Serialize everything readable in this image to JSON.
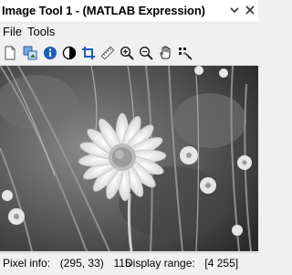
{
  "window": {
    "title": "Image Tool 1 - (MATLAB Expression)",
    "collapse_icon": "chevron-down-icon",
    "close_icon": "close-icon"
  },
  "menu": {
    "items": [
      {
        "label": "File"
      },
      {
        "label": "Tools"
      }
    ]
  },
  "toolbar": {
    "tools": [
      {
        "icon": "new-figure-icon"
      },
      {
        "icon": "export-icon"
      },
      {
        "icon": "image-info-icon"
      },
      {
        "icon": "contrast-icon"
      },
      {
        "icon": "crop-icon"
      },
      {
        "icon": "measure-distance-icon"
      },
      {
        "icon": "zoom-in-icon"
      },
      {
        "icon": "zoom-out-icon"
      },
      {
        "icon": "pan-hand-icon"
      },
      {
        "icon": "pixel-region-icon"
      }
    ]
  },
  "image": {
    "description_icon": "grayscale-flower-image"
  },
  "status": {
    "pixel_info_label": "Pixel info:",
    "pixel_info_coords": "(295, 33)",
    "pixel_info_value": "115",
    "display_range_label": "Display range:",
    "display_range_value": "[4 255]"
  },
  "colors": {
    "accent": "#0a60c8",
    "background": "#f0f0f0"
  }
}
